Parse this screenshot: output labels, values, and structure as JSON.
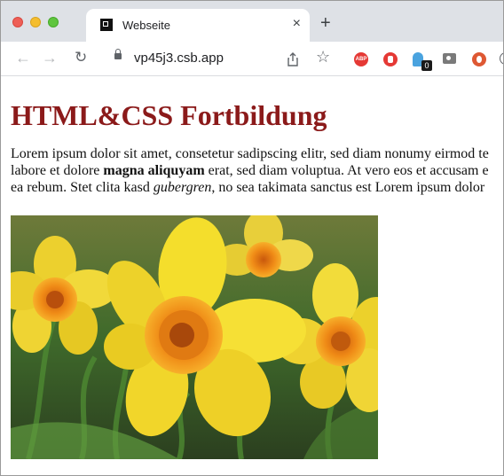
{
  "browser": {
    "tab_title": "Webseite",
    "tab_close": "×",
    "new_tab": "+",
    "url": "vp45j3.csb.app",
    "extensions": {
      "abp_label": "ABP",
      "badge_count": "0"
    }
  },
  "page": {
    "heading": "HTML&CSS Fortbildung",
    "paragraph": {
      "line1": "Lorem ipsum dolor sit amet, consetetur sadipscing elitr, sed diam nonumy eirmod te",
      "line2_before": "labore et dolore ",
      "line2_bold": "magna aliquyam",
      "line2_after": " erat, sed diam voluptua. At vero eos et accusam e",
      "line3_before": "ea rebum. Stet clita kasd ",
      "line3_italic": "gubergren",
      "line3_after": ", no sea takimata sanctus est Lorem ipsum dolor"
    }
  },
  "colors": {
    "heading": "#8b1a1a",
    "tabbar": "#dee1e6",
    "daffodil_petal": "#f1d21f",
    "daffodil_trumpet": "#ef8a16",
    "foliage": "#3f6a2b"
  },
  "icons": [
    "back-arrow-icon",
    "forward-arrow-icon",
    "reload-icon",
    "lock-icon",
    "share-icon",
    "star-icon",
    "abp-icon",
    "stop-icon",
    "ghostery-icon",
    "camera-icon",
    "duckduckgo-icon"
  ]
}
